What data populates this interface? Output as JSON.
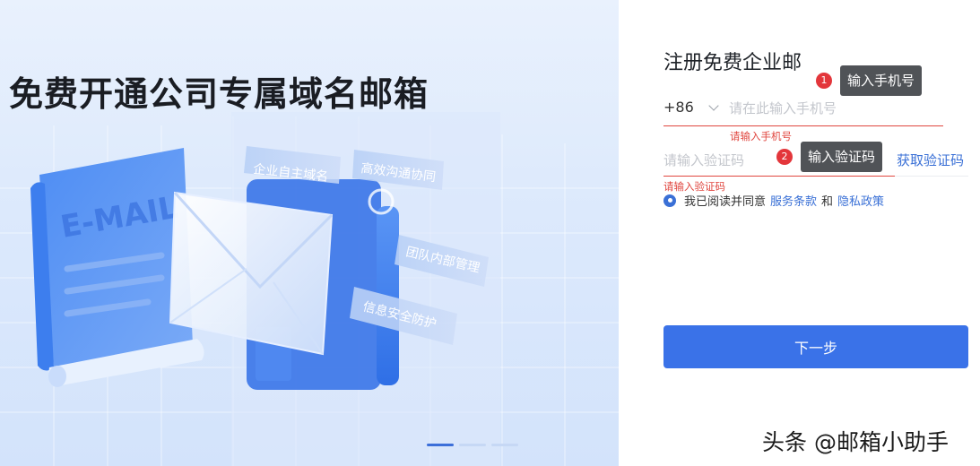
{
  "hero": {
    "title": "免费开通公司专属域名邮箱",
    "illustration": {
      "doc_label": "E-MAIL",
      "cards": [
        "企业自主域名",
        "高效沟通协同",
        "团队内部管理",
        "信息安全防护"
      ]
    },
    "carousel": {
      "count": 3,
      "active_index": 0
    }
  },
  "form": {
    "title": "注册免费企业邮",
    "country_code": "+86",
    "phone_placeholder": "请在此输入手机号",
    "phone_error": "请输入手机号",
    "code_placeholder": "请输入验证码",
    "get_code_label": "获取验证码",
    "code_error": "请输入验证码",
    "agree_text": "我已阅读并同意",
    "terms_link": "服务条款",
    "and_text": "和",
    "privacy_link": "隐私政策",
    "next_label": "下一步"
  },
  "annotations": [
    {
      "number": "1",
      "text": "输入手机号"
    },
    {
      "number": "2",
      "text": "输入验证码"
    }
  ],
  "watermark": "头条 @邮箱小助手",
  "colors": {
    "accent": "#3a72e8",
    "error": "#e0463f",
    "link": "#3a70d6"
  }
}
